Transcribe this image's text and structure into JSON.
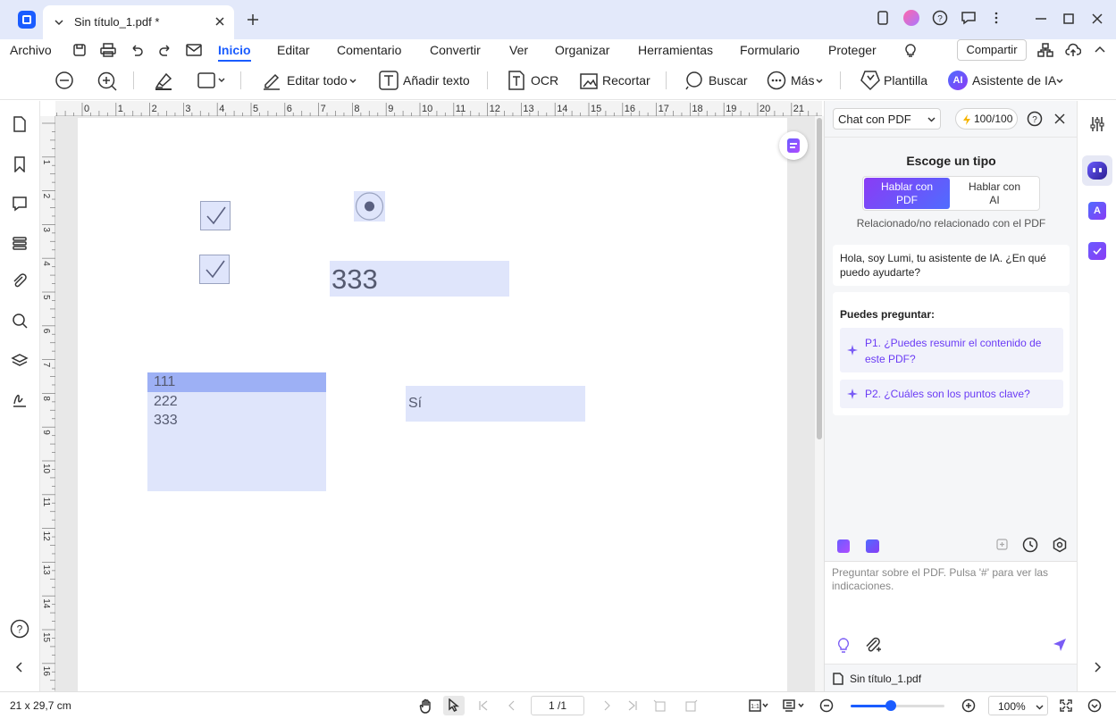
{
  "tab": {
    "title": "Sin título_1.pdf *"
  },
  "menu": {
    "items": [
      "Archivo",
      "Inicio",
      "Editar",
      "Comentario",
      "Convertir",
      "Ver",
      "Organizar",
      "Herramientas",
      "Formulario",
      "Proteger"
    ],
    "active": "Inicio",
    "share": "Compartir"
  },
  "toolbar": {
    "edit_all": "Editar todo",
    "add_text": "Añadir texto",
    "ocr": "OCR",
    "crop": "Recortar",
    "search": "Buscar",
    "more": "Más",
    "template": "Plantilla",
    "ai_badge": "AI",
    "ai_assistant": "Asistente de IA"
  },
  "ruler": {
    "h": [
      "0",
      "1",
      "2",
      "3",
      "4",
      "5",
      "6",
      "7",
      "8",
      "9",
      "10",
      "11",
      "12",
      "13",
      "14",
      "15",
      "16",
      "17",
      "18",
      "19",
      "20",
      "21"
    ],
    "v": [
      "1",
      "2",
      "3",
      "4",
      "5",
      "6",
      "7",
      "8",
      "9",
      "10",
      "11",
      "12",
      "13",
      "14",
      "15",
      "16"
    ]
  },
  "document": {
    "text_field_value": "333",
    "list_items": [
      "111",
      "222",
      "333"
    ],
    "list_selected_index": 0,
    "combo_value": "Sí"
  },
  "panel": {
    "mode_select": "Chat con PDF",
    "credits": "100/100",
    "choose_type": "Escoge un tipo",
    "type_pdf": "Hablar con PDF",
    "type_ai": "Hablar con AI",
    "type_hint": "Relacionado/no relacionado con el PDF",
    "greeting": "Hola, soy Lumi, tu asistente de IA. ¿En qué puedo ayudarte?",
    "can_ask": "Puedes preguntar:",
    "suggestions": [
      "P1. ¿Puedes resumir el contenido de este PDF?",
      "P2. ¿Cuáles son los puntos clave?"
    ],
    "input_placeholder": "Preguntar sobre el PDF. Pulsa '#' para ver las indicaciones.",
    "file_name": "Sin título_1.pdf",
    "accent": "#6b3cf5"
  },
  "status": {
    "page_size": "21 x 29,7 cm",
    "page_indicator": "1 /1",
    "zoom": "100%",
    "zoom_level": 0.43
  }
}
